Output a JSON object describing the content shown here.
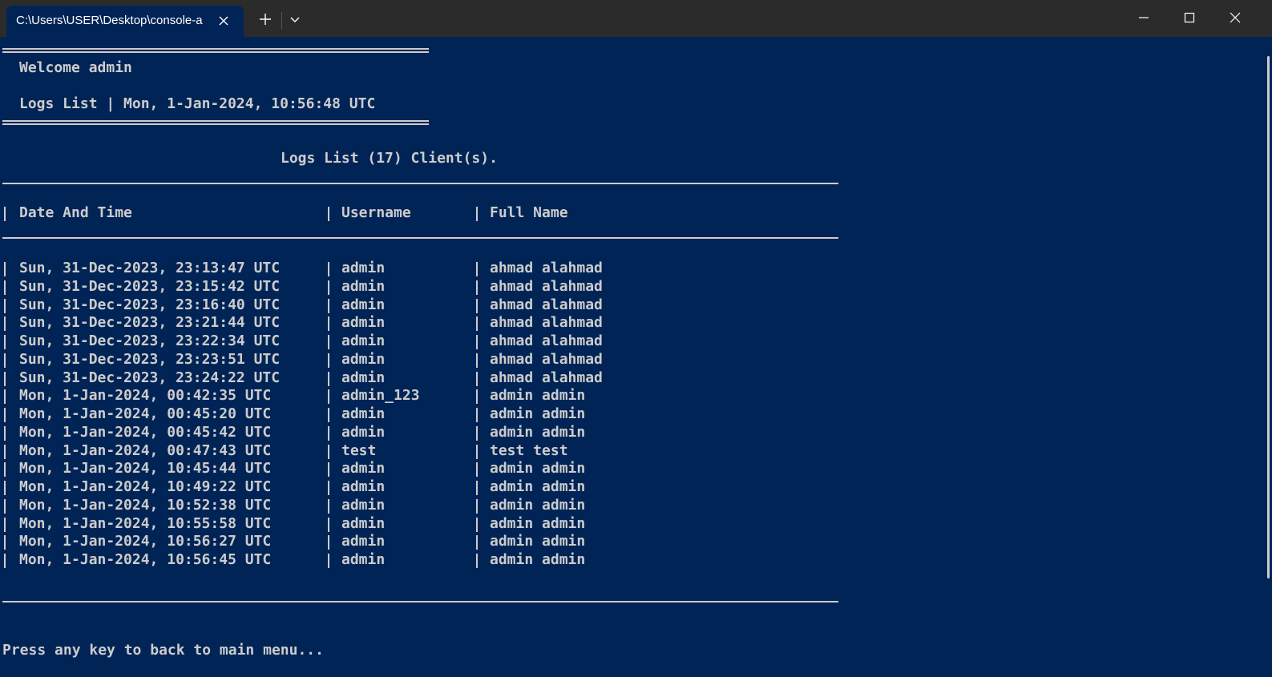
{
  "window": {
    "tab_title": "C:\\Users\\USER\\Desktop\\console-a"
  },
  "header": {
    "welcome": "Welcome admin",
    "screen_title": "Logs List | Mon, 1-Jan-2024, 10:56:48 UTC"
  },
  "logs": {
    "title": "Logs List (17) Client(s).",
    "columns": [
      "Date And Time",
      "Username",
      "Full Name"
    ],
    "rows": [
      [
        "Sun, 31-Dec-2023, 23:13:47 UTC",
        "admin",
        "ahmad alahmad"
      ],
      [
        "Sun, 31-Dec-2023, 23:15:42 UTC",
        "admin",
        "ahmad alahmad"
      ],
      [
        "Sun, 31-Dec-2023, 23:16:40 UTC",
        "admin",
        "ahmad alahmad"
      ],
      [
        "Sun, 31-Dec-2023, 23:21:44 UTC",
        "admin",
        "ahmad alahmad"
      ],
      [
        "Sun, 31-Dec-2023, 23:22:34 UTC",
        "admin",
        "ahmad alahmad"
      ],
      [
        "Sun, 31-Dec-2023, 23:23:51 UTC",
        "admin",
        "ahmad alahmad"
      ],
      [
        "Sun, 31-Dec-2023, 23:24:22 UTC",
        "admin",
        "ahmad alahmad"
      ],
      [
        "Mon, 1-Jan-2024, 00:42:35 UTC",
        "admin_123",
        "admin admin"
      ],
      [
        "Mon, 1-Jan-2024, 00:45:20 UTC",
        "admin",
        "admin admin"
      ],
      [
        "Mon, 1-Jan-2024, 00:45:42 UTC",
        "admin",
        "admin admin"
      ],
      [
        "Mon, 1-Jan-2024, 00:47:43 UTC",
        "test",
        "test test"
      ],
      [
        "Mon, 1-Jan-2024, 10:45:44 UTC",
        "admin",
        "admin admin"
      ],
      [
        "Mon, 1-Jan-2024, 10:49:22 UTC",
        "admin",
        "admin admin"
      ],
      [
        "Mon, 1-Jan-2024, 10:52:38 UTC",
        "admin",
        "admin admin"
      ],
      [
        "Mon, 1-Jan-2024, 10:55:58 UTC",
        "admin",
        "admin admin"
      ],
      [
        "Mon, 1-Jan-2024, 10:56:27 UTC",
        "admin",
        "admin admin"
      ],
      [
        "Mon, 1-Jan-2024, 10:56:45 UTC",
        "admin",
        "admin admin"
      ]
    ]
  },
  "footer": {
    "prompt": "Press any key to back to main menu..."
  },
  "icons": {
    "close_tab": "close-icon",
    "new_tab": "plus-icon",
    "dropdown": "chevron-down-icon",
    "minimize": "minimize-icon",
    "maximize": "maximize-icon",
    "close_window": "close-icon"
  },
  "colors": {
    "background": "#012456",
    "titlebar": "#2b2b2b",
    "text": "#cccccc"
  }
}
